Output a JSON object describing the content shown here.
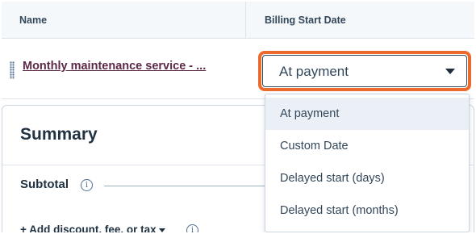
{
  "table": {
    "headers": {
      "name": "Name",
      "billing_start_date": "Billing Start Date"
    },
    "rows": [
      {
        "name": "Monthly maintenance service - ...",
        "billing_start_date": "At payment"
      }
    ]
  },
  "dropdown": {
    "options": [
      "At payment",
      "Custom Date",
      "Delayed start (days)",
      "Delayed start (months)"
    ],
    "selected": "At payment"
  },
  "summary": {
    "title": "Summary",
    "subtotal_label": "Subtotal",
    "add_action": "+ Add discount, fee, or tax"
  },
  "icons": {
    "info": "info-icon",
    "caret": "caret-down-icon",
    "drag": "drag-handle-icon"
  },
  "colors": {
    "focus_ring": "#ec6a2c",
    "link": "#5c2848",
    "text": "#33475b",
    "header_bg": "#f5f8fa",
    "selected_option_bg": "#eaf0f6"
  }
}
